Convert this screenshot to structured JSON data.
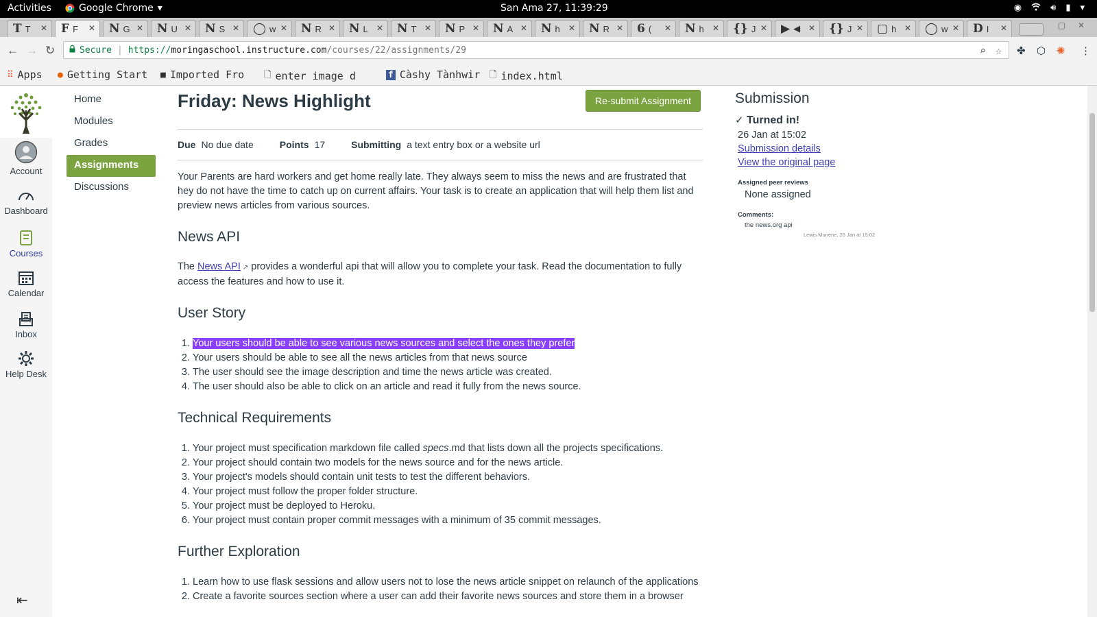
{
  "os_bar": {
    "activities": "Activities",
    "app_name": "Google Chrome",
    "clock": "San Ama 27, 11:39:29"
  },
  "tabs": [
    {
      "icon": "T",
      "title": "T"
    },
    {
      "icon": "F",
      "title": "F"
    },
    {
      "icon": "N",
      "title": "G"
    },
    {
      "icon": "N",
      "title": "U"
    },
    {
      "icon": "N",
      "title": "S"
    },
    {
      "icon": "◯",
      "title": "w"
    },
    {
      "icon": "N",
      "title": "R"
    },
    {
      "icon": "N",
      "title": "L"
    },
    {
      "icon": "N",
      "title": "T"
    },
    {
      "icon": "N",
      "title": "P"
    },
    {
      "icon": "N",
      "title": "A"
    },
    {
      "icon": "N",
      "title": "h"
    },
    {
      "icon": "N",
      "title": "R"
    },
    {
      "icon": "6",
      "title": "("
    },
    {
      "icon": "N",
      "title": "h"
    },
    {
      "icon": "{}",
      "title": "J"
    },
    {
      "icon": "▶",
      "title": "◀"
    },
    {
      "icon": "{}",
      "title": "J"
    },
    {
      "icon": "▢",
      "title": "h"
    },
    {
      "icon": "◯",
      "title": "w"
    },
    {
      "icon": "D",
      "title": "I"
    }
  ],
  "address_bar": {
    "secure_label": "Secure",
    "scheme": "https://",
    "host": "moringaschool.instructure.com",
    "path": "/courses/22/assignments/29"
  },
  "bookmarks": [
    {
      "icon": "apps-grid-icon",
      "label": "Apps"
    },
    {
      "icon": "firefox-icon",
      "label": "Getting Start"
    },
    {
      "icon": "folder-icon",
      "label": "Imported Fro"
    },
    {
      "icon": "page-icon",
      "label": "enter image d"
    },
    {
      "icon": "facebook-icon",
      "label": "Càshy Tànhwir"
    },
    {
      "icon": "page-icon",
      "label": "index.html"
    }
  ],
  "global_nav": [
    {
      "label": "Account",
      "icon": "account-icon"
    },
    {
      "label": "Dashboard",
      "icon": "dashboard-icon"
    },
    {
      "label": "Courses",
      "icon": "courses-icon"
    },
    {
      "label": "Calendar",
      "icon": "calendar-icon"
    },
    {
      "label": "Inbox",
      "icon": "inbox-icon"
    },
    {
      "label": "Help Desk",
      "icon": "help-icon"
    }
  ],
  "course_nav": [
    "Home",
    "Modules",
    "Grades",
    "Assignments",
    "Discussions"
  ],
  "assignment": {
    "title": "Friday: News Highlight",
    "resubmit_label": "Re-submit Assignment",
    "due_label": "Due",
    "due_value": "No due date",
    "points_label": "Points",
    "points_value": "17",
    "submitting_label": "Submitting",
    "submitting_value": "a text entry box or a website url",
    "intro": "Your Parents are hard workers and get home really late. They always seem to miss the news and are frustrated that hey do not have the time to catch up on current affairs. Your task is to create an application that will help them list and preview news articles from various sources.",
    "news_api_heading": "News API",
    "news_api_pre": "The ",
    "news_api_link": "News API",
    "news_api_post": " provides a wonderful api that will allow you to complete your task. Read the documentation to fully access the features and how to use it.",
    "user_story_heading": "User Story",
    "user_story": [
      "Your users should be able to see various news sources and select the ones they prefer",
      "Your users should be able to see all the news articles from that news source",
      "The user should see the image description and time the news article was created.",
      "The user should also be able to click on an article and read it fully from the news source."
    ],
    "tech_heading": "Technical Requirements",
    "tech_1_pre": "Your project must specification markdown file called ",
    "tech_1_em": "specs",
    "tech_1_post": ".md that lists down all the projects specifications.",
    "tech": [
      "Your project should contain two models for the news source and for the news article.",
      "Your project's models should contain unit tests to test the different behaviors.",
      "Your project must follow the proper folder structure.",
      "Your project must be deployed to Heroku.",
      "Your project must contain proper commit messages with a minimum of 35 commit messages."
    ],
    "further_heading": "Further Exploration",
    "further": [
      "Learn how to use flask sessions and allow users not to lose the news article snippet on relaunch of the applications",
      "Create a favorite sources section where a user can add their favorite news sources and store them in a browser"
    ]
  },
  "submission": {
    "heading": "Submission",
    "status": "Turned in!",
    "date": "26 Jan at 15:02",
    "details_link": "Submission details",
    "original_link": "View the original page",
    "peer_heading": "Assigned peer reviews",
    "peer_value": "None assigned",
    "comments_heading": "Comments:",
    "comment_text": "the news.org api",
    "comment_author": "Lewis Munene, 26 Jan at 15:02"
  },
  "colors": {
    "canvas_green": "#7ba33f",
    "link_purple": "#3f3fb1",
    "highlight": "#8a3ffc"
  }
}
